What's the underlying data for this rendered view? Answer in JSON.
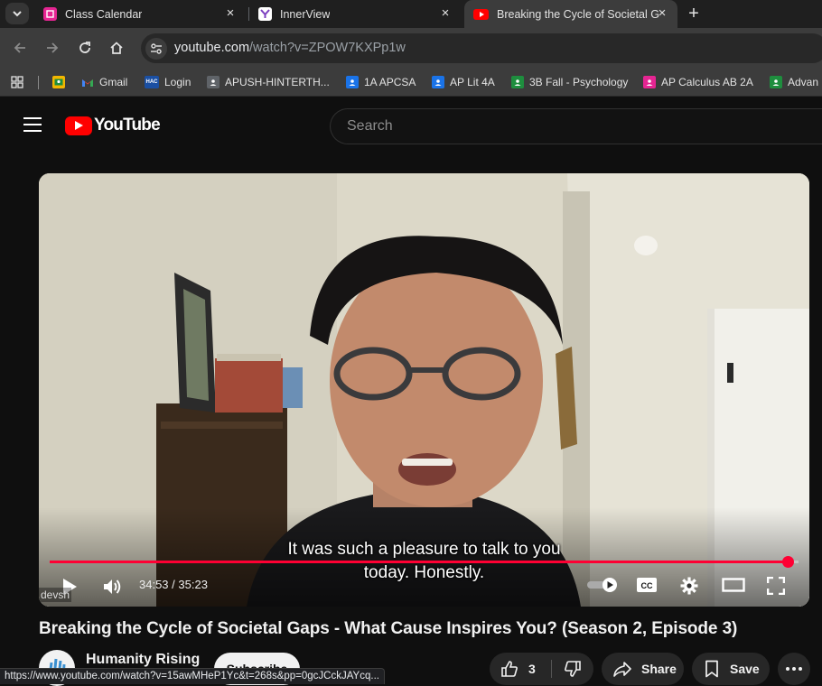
{
  "browser": {
    "tabs": [
      {
        "title": "Class Calendar",
        "active": false
      },
      {
        "title": "InnerView",
        "active": false
      },
      {
        "title": "Breaking the Cycle of Societal G",
        "active": true
      }
    ],
    "address": {
      "host": "youtube.com",
      "path": "/watch?v=ZPOW7KXPp1w"
    },
    "bookmarks": [
      {
        "label": "",
        "icon": "classroom-icon"
      },
      {
        "label": "Gmail",
        "icon": "gmail-icon"
      },
      {
        "label": "Login",
        "icon": "hac-icon",
        "badge": "HAC"
      },
      {
        "label": "APUSH-HINTERTH...",
        "icon": "classroom-icon"
      },
      {
        "label": "1A APCSA",
        "icon": "classroom-icon"
      },
      {
        "label": "AP Lit 4A",
        "icon": "classroom-icon"
      },
      {
        "label": "3B Fall - Psychology",
        "icon": "classroom-icon"
      },
      {
        "label": "AP Calculus AB 2A",
        "icon": "classroom-icon"
      },
      {
        "label": "Advan",
        "icon": "classroom-icon"
      }
    ],
    "status_url": "https://www.youtube.com/watch?v=15awMHeP1Yc&t=268s&pp=0gcJCckJAYcq..."
  },
  "youtube": {
    "logo_text": "YouTube",
    "search_placeholder": "Search"
  },
  "player": {
    "captions": [
      "It was such a pleasure to talk to you",
      "today. Honestly."
    ],
    "time_current": "34:53",
    "time_total": "35:23",
    "progress_fraction": 0.986,
    "watermark": "devsh",
    "cc_label": "CC"
  },
  "video": {
    "title": "Breaking the Cycle of Societal Gaps - What Cause Inspires You? (Season 2, Episode 3)",
    "channel": "Humanity Rising",
    "subscribe_label": "Subscribe",
    "likes": "3",
    "share_label": "Share",
    "save_label": "Save"
  },
  "colors": {
    "accent": "#ff0033",
    "youtube_red": "#ff0000"
  }
}
